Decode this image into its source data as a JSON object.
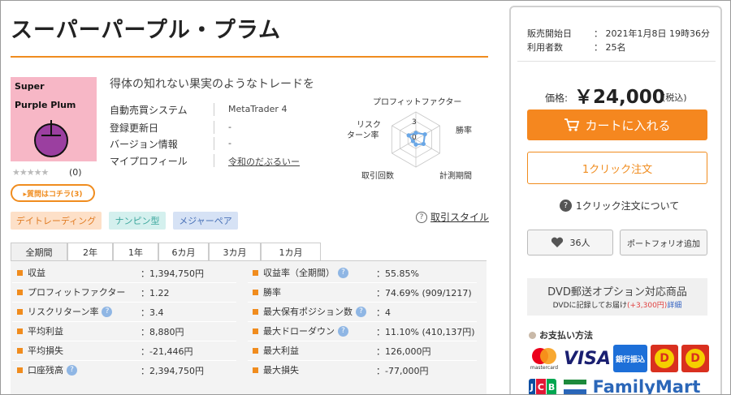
{
  "product": {
    "title": "スーパーパープル・プラム",
    "thumb_line1": "Super",
    "thumb_line2": "Purple Plum",
    "stars": "★★★★★",
    "review_count": "(0)",
    "question_button": "▸質問はコチラ(3)",
    "tagline": "得体の知れない果実のようなトレードを"
  },
  "info": [
    {
      "label": "自動売買システム",
      "value": "MetaTrader 4"
    },
    {
      "label": "登録更新日",
      "value": "-"
    },
    {
      "label": "バージョン情報",
      "value": "-"
    },
    {
      "label": "マイプロフィール",
      "value": "令和のだぶるいー"
    }
  ],
  "radar": {
    "labels": {
      "top": "プロフィットファクター",
      "left_top": "リスク",
      "left_bottom": "ターン率",
      "right": "勝率",
      "bottom_right": "計測期間",
      "bottom_left": "取引回数"
    },
    "scale_3": "3",
    "scale_0": "0",
    "values": [
      1.2,
      1.9,
      1.6,
      0.9,
      0.6,
      1.5
    ],
    "max": 5,
    "color": "#6aa7e6"
  },
  "tags": [
    "デイトレーディング",
    "ナンピン型",
    "メジャーペア"
  ],
  "trade_style_link": "取引スタイル",
  "tabs": [
    "全期間",
    "2年",
    "1年",
    "6カ月",
    "3カ月",
    "1カ月"
  ],
  "stats_left": [
    {
      "label": "収益",
      "value": "：1,394,750円",
      "help": false
    },
    {
      "label": "プロフィットファクター",
      "value": "：1.22",
      "help": false
    },
    {
      "label": "リスクリターン率",
      "value": "：3.4",
      "help": true
    },
    {
      "label": "平均利益",
      "value": "：8,880円",
      "help": false
    },
    {
      "label": "平均損失",
      "value": "：-21,446円",
      "help": false
    },
    {
      "label": "口座残高",
      "value": "：2,394,750円",
      "help": true
    }
  ],
  "stats_right": [
    {
      "label": "収益率（全期間）",
      "value": "：55.85%",
      "help": true
    },
    {
      "label": "勝率",
      "value": "：74.69% (909/1217)",
      "help": false
    },
    {
      "label": "最大保有ポジション数",
      "value": "：4",
      "help": true
    },
    {
      "label": "最大ドローダウン",
      "value": "：11.10% (410,137円)",
      "help": true
    },
    {
      "label": "最大利益",
      "value": "：126,000円",
      "help": false
    },
    {
      "label": "最大損失",
      "value": "：-77,000円",
      "help": false
    }
  ],
  "sidebar": {
    "sale_start_label": "販売開始日",
    "sale_start_value": "：  2021年1月8日 19時36分",
    "users_label": "利用者数",
    "users_value": "：  25名",
    "price_label": "価格:",
    "price": "￥24,000",
    "tax": "(税込)",
    "cart_button": "カートに入れる",
    "oneclick_button": "1クリック注文",
    "oneclick_about": "1クリック注文について",
    "favorite_count": "36人",
    "portfolio_button": "ポートフォリオ追加",
    "dvd_title": "DVD郵送オプション対応商品",
    "dvd_sub_prefix": "DVDに記録してお届け",
    "dvd_sub_price": "(+3,300円)",
    "dvd_sub_link": "詳細",
    "payment_label": "お支払い方法",
    "logos": {
      "mastercard": "mastercard",
      "visa": "VISA",
      "bank": "銀行振込",
      "jcb": "JCB",
      "familymart": "FamilyMart"
    }
  },
  "colors": {
    "accent": "#f08c1e",
    "cart": "#f5871f",
    "thumb_bg": "#f7b7c6",
    "plum": "#9b3fa0"
  }
}
